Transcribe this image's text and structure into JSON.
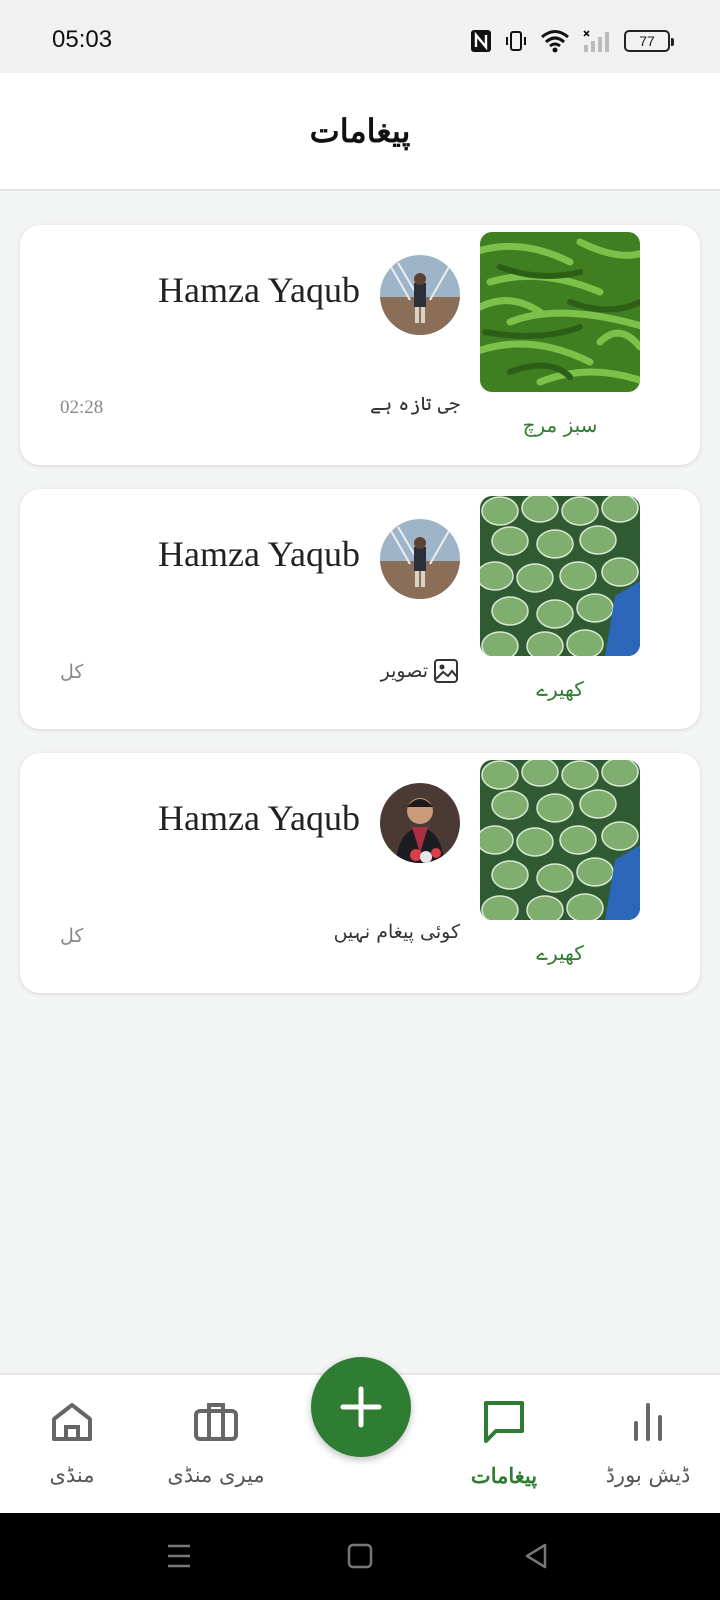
{
  "status_bar": {
    "time": "05:03",
    "battery": "77"
  },
  "header": {
    "title": "پیغامات"
  },
  "conversations": [
    {
      "contact_name": "Hamza Yaqub",
      "product": "سبز مرچ",
      "last_message": "جی تازہ ہے",
      "time": "02:28",
      "has_image_icon": false
    },
    {
      "contact_name": "Hamza Yaqub",
      "product": "کھیرے",
      "last_message": "تصویر",
      "time": "کل",
      "has_image_icon": true
    },
    {
      "contact_name": "Hamza Yaqub",
      "product": "کھیرے",
      "last_message": "کوئی پیغام نہیں",
      "time": "کل",
      "has_image_icon": false
    }
  ],
  "bottom_nav": {
    "items": [
      {
        "label": "منڈی",
        "icon": "home-icon",
        "active": false
      },
      {
        "label": "میری منڈی",
        "icon": "briefcase-icon",
        "active": false
      },
      {
        "label": "پیغامات",
        "icon": "chat-icon",
        "active": true
      },
      {
        "label": "ڈیش بورڈ",
        "icon": "bar-chart-icon",
        "active": false
      }
    ],
    "fab_icon": "plus-icon"
  },
  "colors": {
    "accent": "#2e7d32",
    "background": "#f3f4f4"
  }
}
